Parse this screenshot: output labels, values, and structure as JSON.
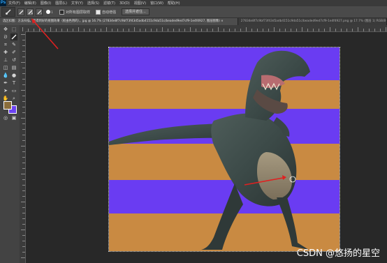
{
  "app": {
    "logo": "Ps"
  },
  "menu": [
    "文件(F)",
    "编辑(E)",
    "图像(I)",
    "图层(L)",
    "文字(Y)",
    "选择(S)",
    "滤镜(T)",
    "3D(D)",
    "视图(V)",
    "窗口(W)",
    "帮助(H)"
  ],
  "options": {
    "size_value": "1",
    "sample_all_layers": "对所有图层取样",
    "auto_enhance": "自动增强",
    "select_subject": "选择并遮住..."
  },
  "tabs": [
    {
      "label": "选区扣图：方法扫描，能得到好的抠图效果（抠由色用的），jpg @ 16.7% (27834e8f7c9bf73f43d5adb4151c9da51c/beaded9ed7cf9-1e4f4927, 图层图像) ×",
      "active": true
    },
    {
      "label": "27834e8f7c9bf73f43d5adb4151c9da51c/beaded9ed7cf9-1e4f4927.png @ 17.7% (图层 1) RGB/8#) ×",
      "active": false
    }
  ],
  "colors": {
    "stripe_purple": "#6a3cf2",
    "stripe_orange": "#c98a42",
    "arrow_red": "#e02020",
    "foreground": "#8a6d3b",
    "background": "#6c43f2"
  },
  "watermark": "CSDN @悠扬的星空"
}
